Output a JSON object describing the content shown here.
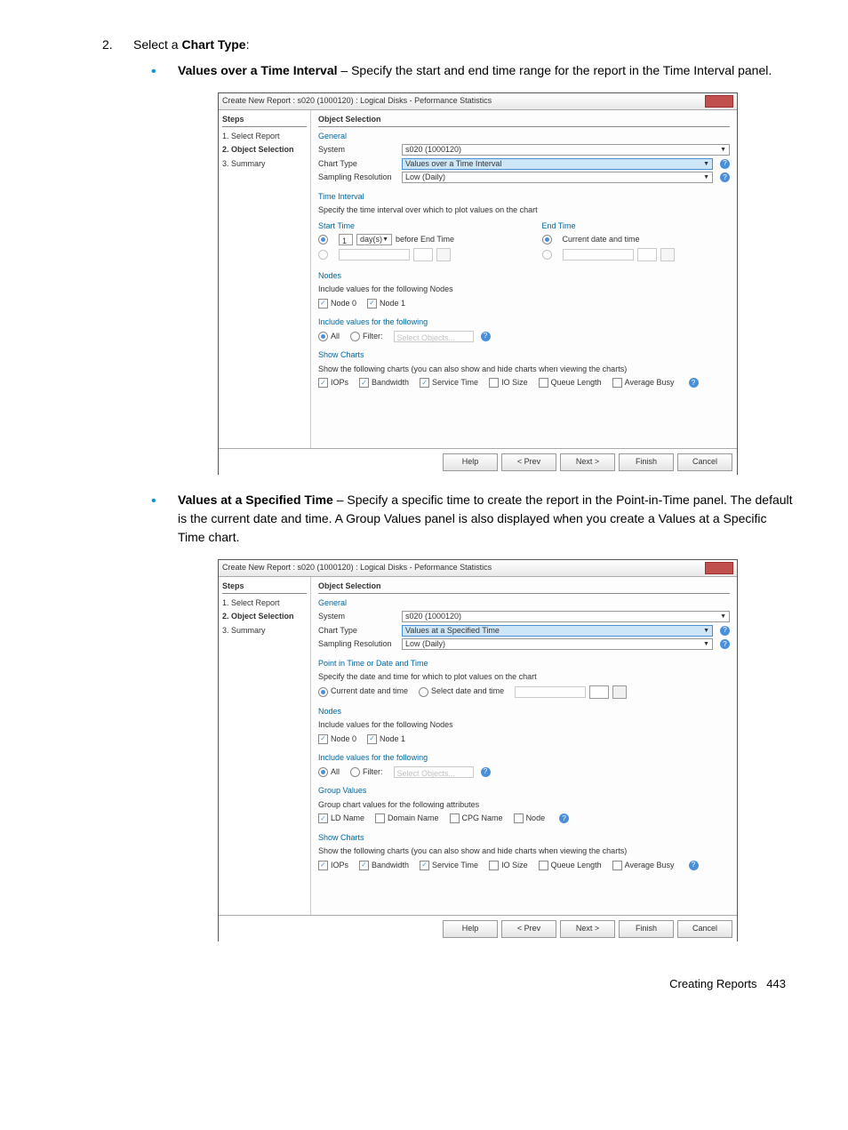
{
  "step2": {
    "number": "2.",
    "lead": "Select a ",
    "bold": "Chart Type",
    "tail": ":"
  },
  "bullet_a": {
    "bold": "Values over a Time Interval",
    "text": " – Specify the start and end time range for the report in the Time Interval panel."
  },
  "bullet_b": {
    "bold": "Values at a Specified Time",
    "text": " – Specify a specific time to create the report in the Point-in-Time panel. The default is the current date and time. A Group Values panel is also displayed when you create a Values at a Specific Time chart."
  },
  "dlg1": {
    "window_title": "Create New Report : s020 (1000120) : Logical Disks - Peformance Statistics",
    "steps_header": "Steps",
    "step1": "1. Select Report",
    "step2": "2. Object Selection",
    "step3": "3. Summary",
    "main_title": "Object Selection",
    "general": "General",
    "system_label": "System",
    "system_value": "s020 (1000120)",
    "chart_type_label": "Chart Type",
    "chart_type_value": "Values over a Time Interval",
    "sampling_label": "Sampling Resolution",
    "sampling_value": "Low (Daily)",
    "time_interval": "Time Interval",
    "ti_desc": "Specify the time interval over which to plot values on the chart",
    "start_time": "Start Time",
    "end_time": "End Time",
    "days_unit": "day(s)",
    "before_end": "before End Time",
    "current_dt": "Current date and time",
    "one": "1",
    "nodes": "Nodes",
    "nodes_desc": "Include values for the following Nodes",
    "node0": "Node 0",
    "node1": "Node 1",
    "incl_values": "Include values for the following",
    "filter_all": "All",
    "filter_filter": "Filter:",
    "filter_placeholder": "Select Objects...",
    "show_charts": "Show Charts",
    "show_charts_desc": "Show the following charts (you can also show and hide charts when viewing the charts)",
    "c_iops": "IOPs",
    "c_bw": "Bandwidth",
    "c_svc": "Service Time",
    "c_iosize": "IO Size",
    "c_queue": "Queue Length",
    "c_avgbusy": "Average Busy",
    "btn_help": "Help",
    "btn_prev": "< Prev",
    "btn_next": "Next >",
    "btn_finish": "Finish",
    "btn_cancel": "Cancel"
  },
  "dlg2": {
    "chart_type_value": "Values at a Specified Time",
    "pit_title": "Point in Time or Date and Time",
    "pit_desc": "Specify the date and time for which to plot values on the chart",
    "sel_dt": "Select date and time",
    "group_values": "Group Values",
    "group_desc": "Group chart values for the following attributes",
    "g_ldname": "LD Name",
    "g_domain": "Domain Name",
    "g_cpg": "CPG Name",
    "g_node": "Node"
  },
  "footer": {
    "text": "Creating Reports",
    "page": "443"
  }
}
